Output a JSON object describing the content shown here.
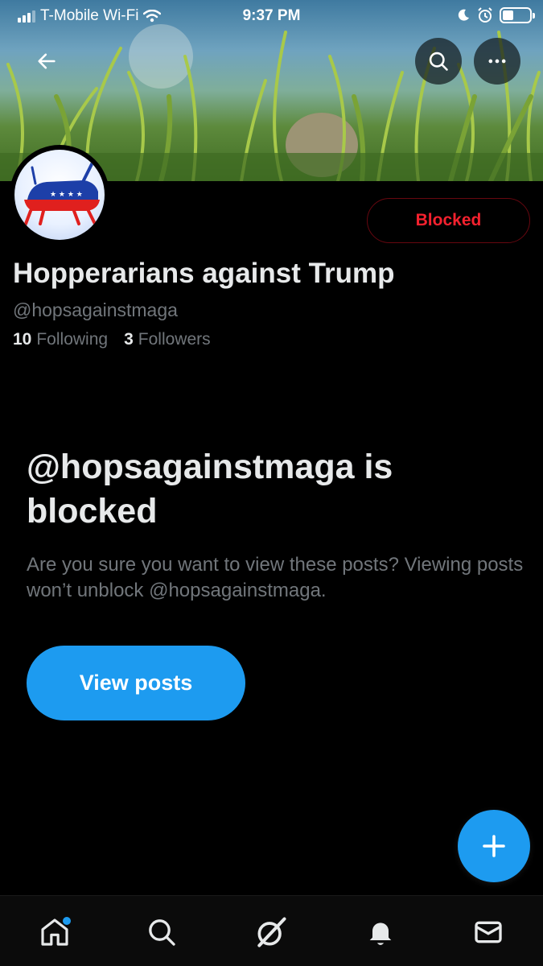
{
  "status_bar": {
    "carrier": "T-Mobile Wi-Fi",
    "time": "9:37 PM",
    "battery_level": 0.4
  },
  "header": {
    "back_icon": "arrow-left-icon",
    "search_icon": "search-icon",
    "more_icon": "more-horizontal-icon"
  },
  "profile": {
    "display_name": "Hopperarians against Trump",
    "handle": "@hopsagainstmaga",
    "following_count": "10",
    "following_label": "Following",
    "followers_count": "3",
    "followers_label": "Followers",
    "blocked_button_label": "Blocked"
  },
  "blocked_notice": {
    "title": "@hopsagainstmaga is blocked",
    "description": "Are you sure you want to view these posts? Viewing posts won’t unblock @hopsagainstmaga.",
    "button_label": "View posts"
  },
  "compose_button": {
    "icon": "plus-icon"
  },
  "tab_bar": {
    "items": [
      {
        "icon": "home-icon",
        "has_dot": true
      },
      {
        "icon": "search-icon"
      },
      {
        "icon": "grok-icon"
      },
      {
        "icon": "bell-icon"
      },
      {
        "icon": "mail-icon"
      }
    ]
  },
  "colors": {
    "accent": "#1d9bf0",
    "blocked_red": "#f4212e",
    "secondary_text": "#71767b",
    "primary_text": "#e7e9ea"
  }
}
